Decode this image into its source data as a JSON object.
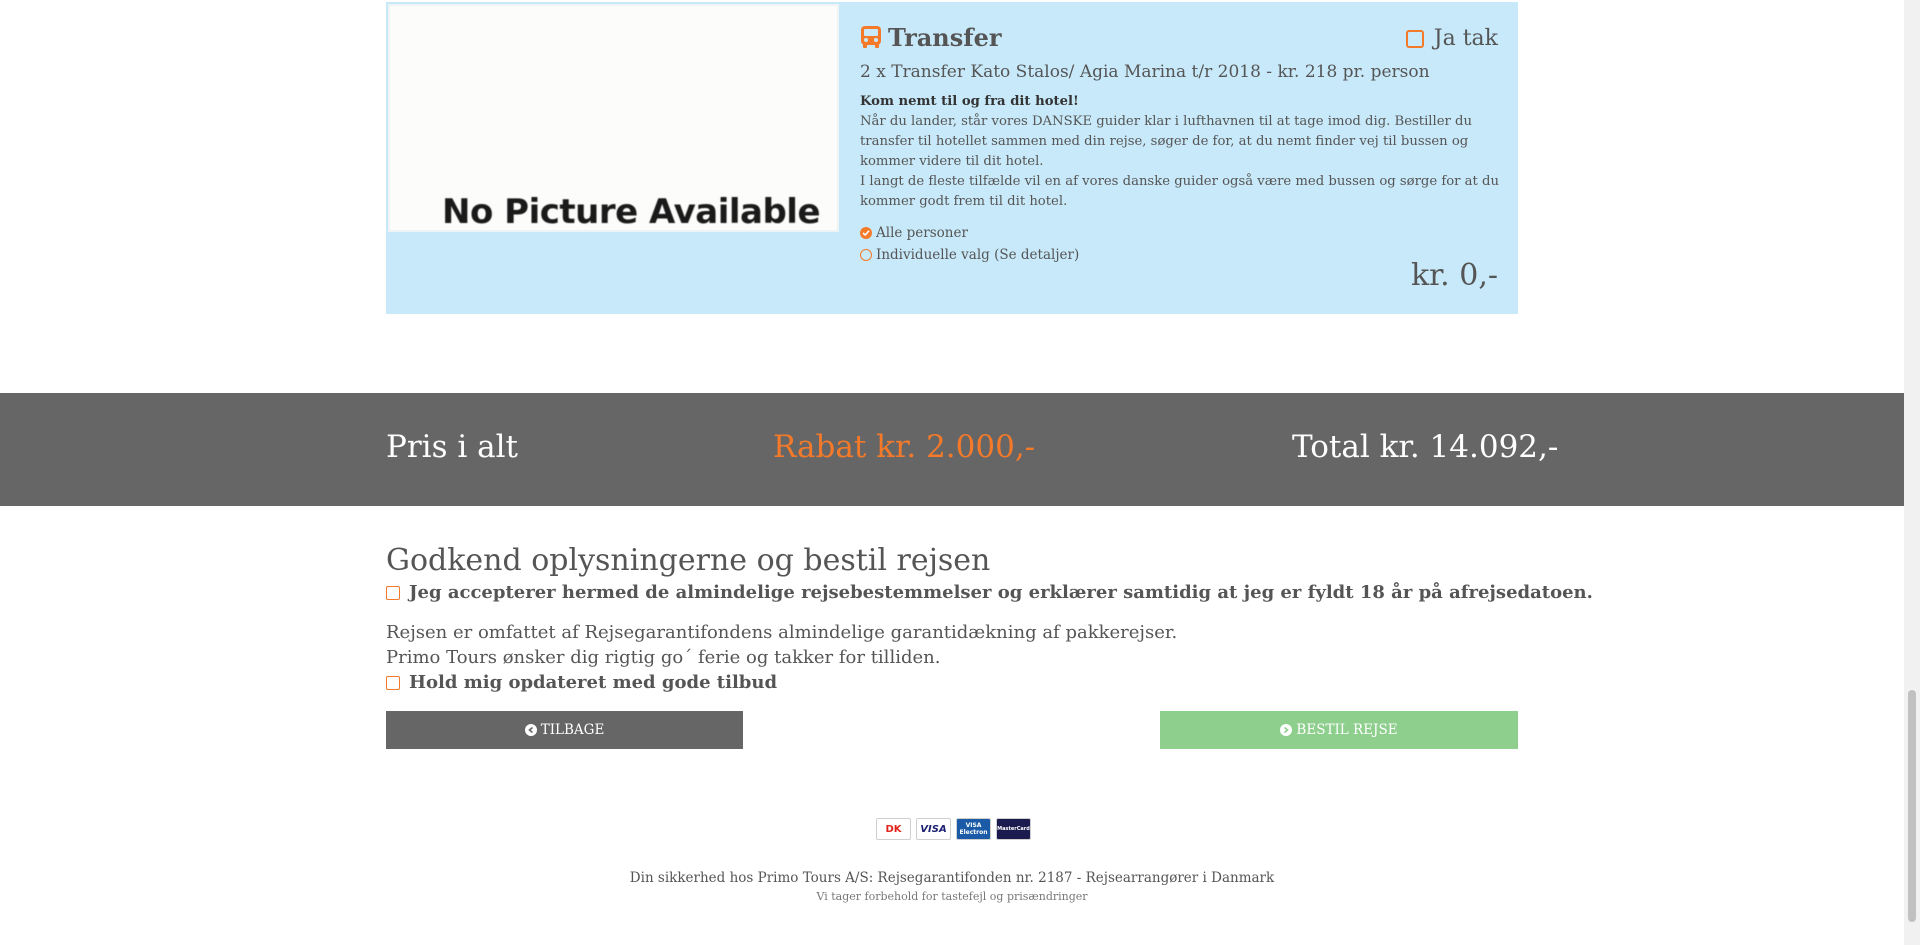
{
  "transfer": {
    "image_text": "No Picture Available",
    "title": "Transfer",
    "subtitle": "2 x Transfer Kato Stalos/ Agia Marina t/r 2018 - kr. 218 pr. person",
    "lead": "Kom nemt til og fra dit hotel!",
    "desc1": "Når du lander, står vores DANSKE guider klar i lufthavnen til at tage imod dig. Bestiller du transfer til hotellet sammen med din rejse, søger de for, at du nemt finder vej til bussen og kommer videre til dit hotel.",
    "desc2": "I langt de fleste tilfælde vil en af vores danske guider også være med bussen og sørge for at du kommer godt frem til dit hotel.",
    "option_all": "Alle personer",
    "option_individual": "Individuelle valg (Se detaljer)",
    "accept_label": "Ja tak",
    "price": "kr. 0,-",
    "icon": "bus-icon"
  },
  "totals": {
    "label": "Pris i alt",
    "discount": "Rabat kr. 2.000,-",
    "total": "Total kr. 14.092,-"
  },
  "confirm": {
    "title": "Godkend oplysningerne og bestil rejsen",
    "terms_label": "Jeg accepterer hermed de almindelige rejsebestemmelser og erklærer samtidig at jeg er fyldt 18 år på afrejsedatoen.",
    "info_line1": "Rejsen er omfattet af Rejsegarantifondens almindelige garantidækning af pakkerejser.",
    "info_line2": "Primo Tours ønsker dig rigtig go´ ferie og takker for tilliden.",
    "newsletter_label": "Hold mig opdateret med gode tilbud",
    "back_button": "TILBAGE",
    "order_button": "BESTIL REJSE"
  },
  "payment_cards": [
    "DK",
    "VISA",
    "VISA Electron",
    "MasterCard"
  ],
  "footer": {
    "line1": "Din sikkerhed hos Primo Tours A/S: Rejsegarantifonden nr. 2187 - Rejsearrangører i Danmark",
    "line2": "Vi tager forbehold for tastefejl og prisændringer"
  },
  "colors": {
    "accent": "#f47a2a",
    "card_bg": "#c8e9f9",
    "bar_bg": "#666666",
    "order_button": "#8ecf8e"
  }
}
